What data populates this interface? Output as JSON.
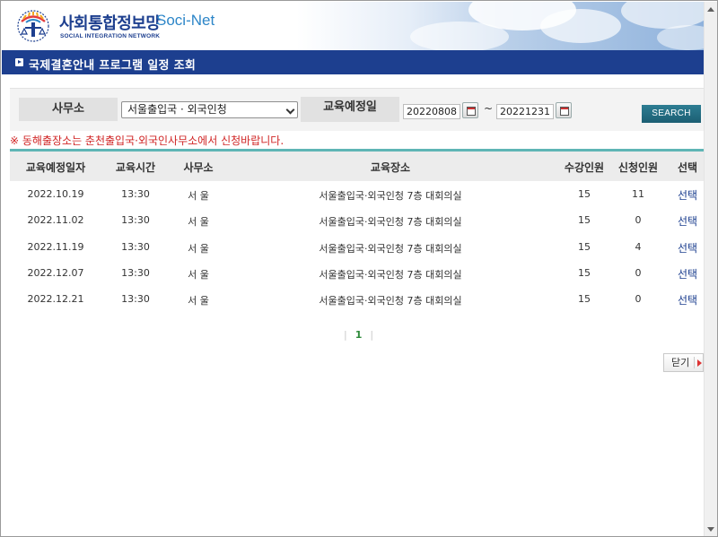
{
  "header": {
    "logo_korean": "사회통합정보망",
    "logo_english": "Soci-Net",
    "logo_sub": "SOCIAL INTEGRATION NETWORK"
  },
  "page_title": "국제결혼안내 프로그램 일정 조회",
  "search": {
    "office_label": "사무소",
    "office_value": "서울출입국 · 외국인청",
    "date_label": "교육예정일",
    "date_from": "20220808",
    "date_to": "20221231",
    "separator": "~",
    "search_button": "SEARCH"
  },
  "notice": "※ 동해출장소는 춘천출입국·외국인사무소에서 신청바랍니다.",
  "table": {
    "headers": {
      "date": "교육예정일자",
      "time": "교육시간",
      "office": "사무소",
      "place": "교육장소",
      "capacity": "수강인원",
      "applied": "신청인원",
      "select": "선택"
    },
    "rows": [
      {
        "date": "2022.10.19",
        "time": "13:30",
        "office": "서 울",
        "place": "서울출입국·외국인청 7층 대회의실",
        "capacity": "15",
        "applied": "11",
        "select": "선택"
      },
      {
        "date": "2022.11.02",
        "time": "13:30",
        "office": "서 울",
        "place": "서울출입국·외국인청 7층 대회의실",
        "capacity": "15",
        "applied": "0",
        "select": "선택"
      },
      {
        "date": "2022.11.19",
        "time": "13:30",
        "office": "서 울",
        "place": "서울출입국·외국인청 7층 대회의실",
        "capacity": "15",
        "applied": "4",
        "select": "선택"
      },
      {
        "date": "2022.12.07",
        "time": "13:30",
        "office": "서 울",
        "place": "서울출입국·외국인청 7층 대회의실",
        "capacity": "15",
        "applied": "0",
        "select": "선택"
      },
      {
        "date": "2022.12.21",
        "time": "13:30",
        "office": "서 울",
        "place": "서울출입국·외국인청 7층 대회의실",
        "capacity": "15",
        "applied": "0",
        "select": "선택"
      }
    ]
  },
  "pagination": {
    "current_page": "1"
  },
  "close_button": "닫기",
  "icons": {
    "title_bullet": "square-arrow-icon",
    "calendar": "calendar-icon",
    "dropdown": "chevron-down-icon",
    "close_arrow": "triangle-right-icon"
  },
  "colors": {
    "brand_navy": "#1d3f8f",
    "brand_blue": "#2d86c8",
    "teal_accent": "#5fb5b5",
    "search_button": "#1c5f73",
    "notice_red": "#d02525",
    "page_number_green": "#2e8a3a"
  }
}
